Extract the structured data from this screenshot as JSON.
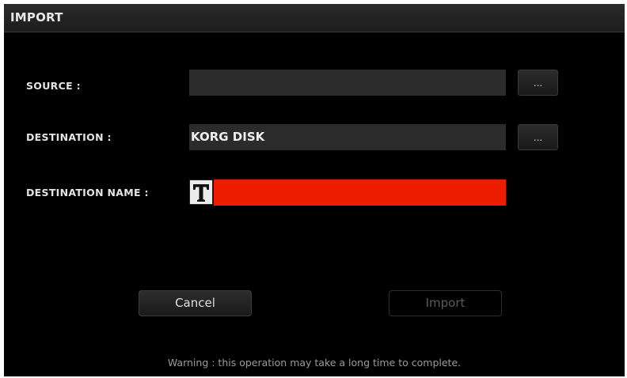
{
  "dialog": {
    "title": "IMPORT"
  },
  "source": {
    "label": "SOURCE :",
    "value": "",
    "browse_label": "..."
  },
  "destination": {
    "label": "DESTINATION :",
    "value": "KORG DISK",
    "browse_label": "..."
  },
  "destination_name": {
    "label": "DESTINATION NAME :",
    "value": "",
    "text_icon": "text-edit-icon",
    "highlight_color": "#ee1d00"
  },
  "actions": {
    "cancel_label": "Cancel",
    "import_label": "Import",
    "import_enabled": false
  },
  "warning": "Warning : this operation may take a long time to complete."
}
